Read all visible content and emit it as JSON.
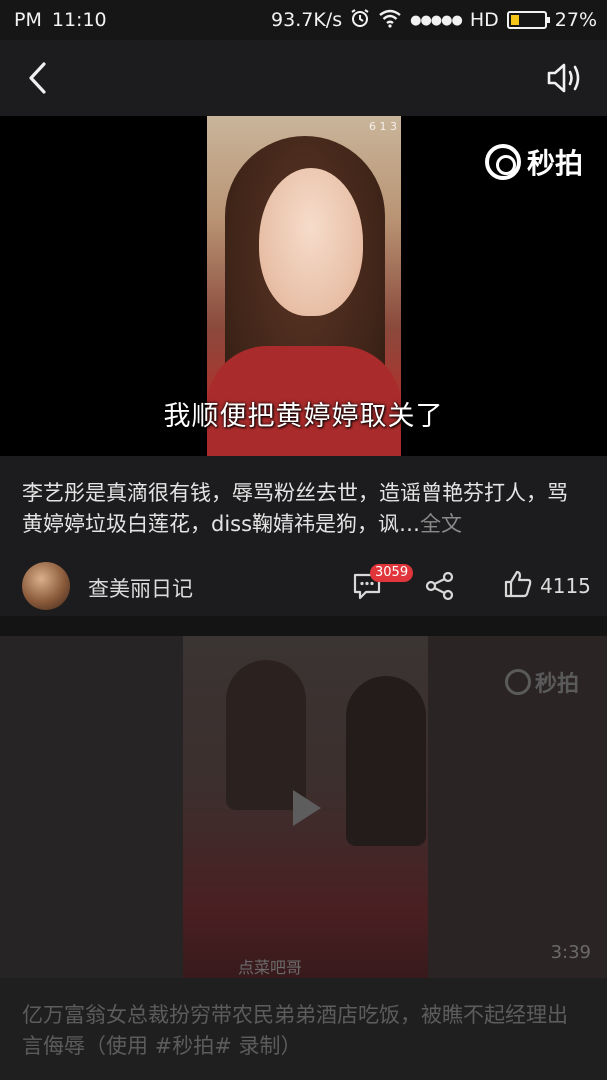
{
  "status_bar": {
    "ampm": "PM",
    "time": "11:10",
    "net_speed": "93.7K/s",
    "signal_dots": "●●●●●",
    "hd": "HD",
    "battery": "27%",
    "battery_level": 0.27
  },
  "nav": {
    "back_icon": "chevron-left-icon",
    "sound_icon": "speaker-icon"
  },
  "video": {
    "watermark": "秒拍",
    "frame_tag": "6 1 3",
    "subtitle": "我顺便把黄婷婷取关了"
  },
  "post": {
    "text": "李艺彤是真滴很有钱，辱骂粉丝去世，造谣曾艳芬打人，骂黄婷婷垃圾白莲花，diss鞠婧祎是狗，讽…",
    "read_more": "全文",
    "author": "查美丽日记",
    "comment_count": "3059",
    "like_count": "4115"
  },
  "next_post": {
    "watermark": "秒拍",
    "duration": "3:39",
    "thumb_caption": "点菜吧哥",
    "text": "亿万富翁女总裁扮穷带农民弟弟酒店吃饭，被瞧不起经理出言侮辱（使用 #秒拍# 录制）"
  },
  "colors": {
    "background": "#1c1c1e",
    "badge": "#e0353a",
    "battery": "#f5c518"
  }
}
